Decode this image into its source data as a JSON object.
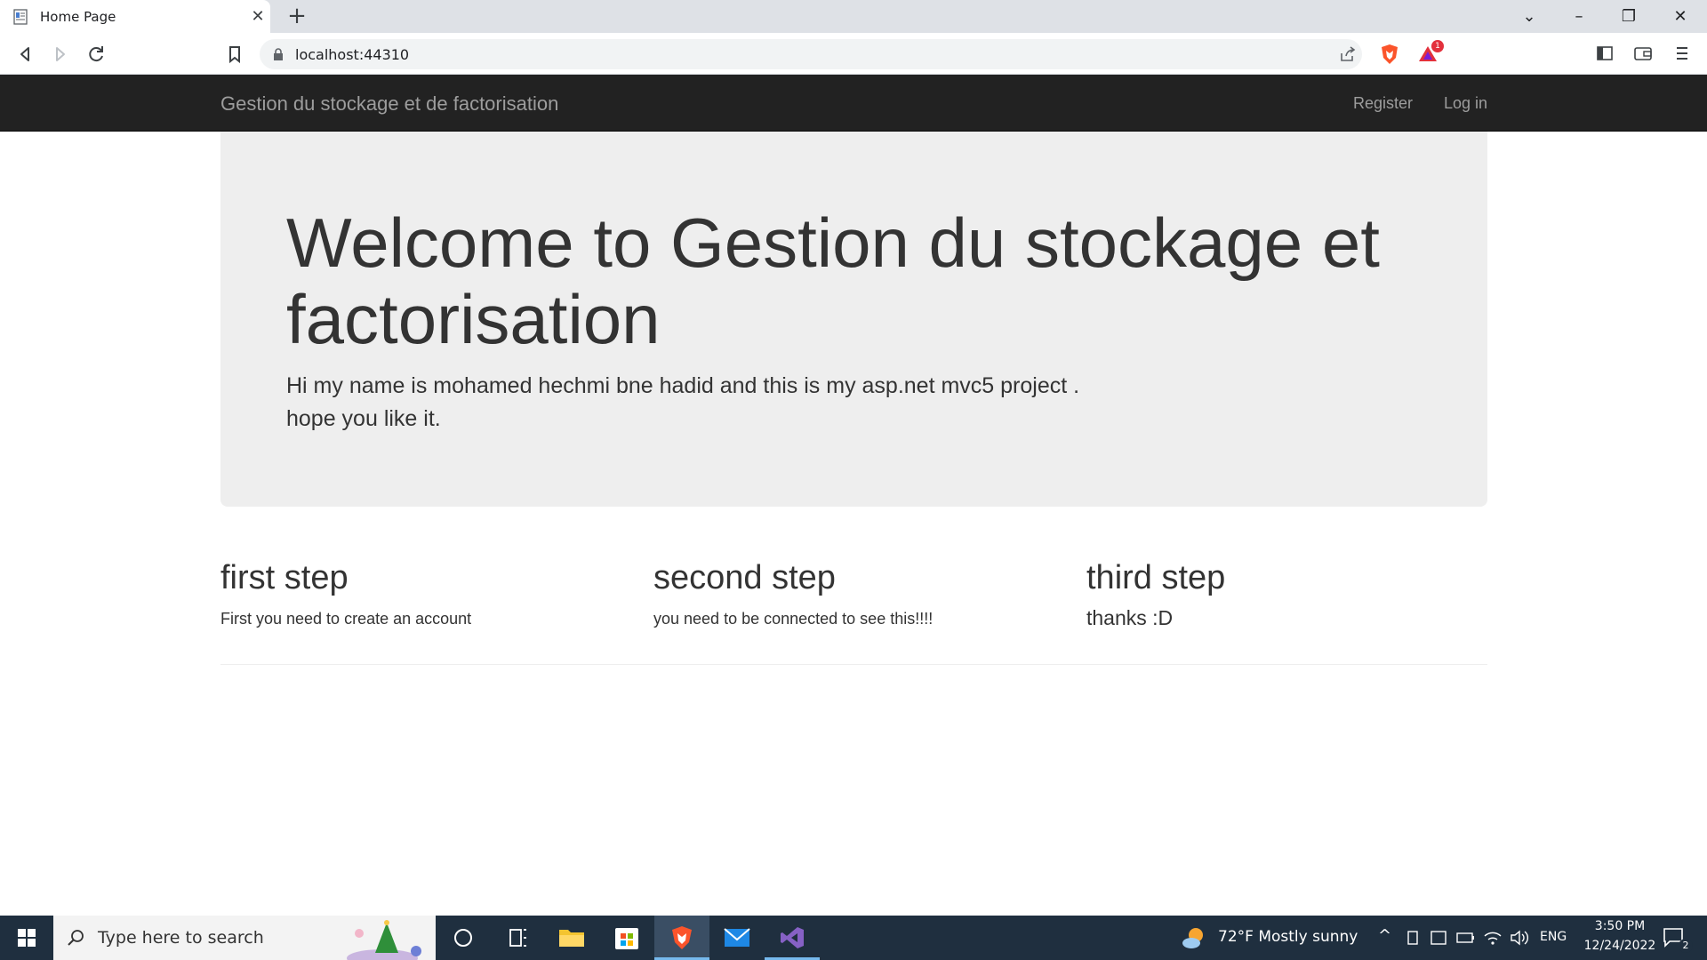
{
  "browser": {
    "tab_title": "Home Page",
    "tab_close": "✕",
    "new_tab": "+",
    "url": "localhost:44310",
    "badge_count": "1",
    "window_buttons": {
      "minimize": "–",
      "restore": "❐",
      "close": "✕",
      "tab_search": "⌄"
    }
  },
  "site": {
    "brand": "Gestion du stockage et de factorisation",
    "nav": {
      "register": "Register",
      "login": "Log in"
    },
    "jumbotron": {
      "title": "Welcome to Gestion du stockage et factorisation",
      "text_line1": "Hi my name is mohamed hechmi bne hadid and this is my asp.net mvc5 project .",
      "text_line2": "hope you like it."
    },
    "columns": [
      {
        "heading": "first step",
        "text": "First you need to create an account"
      },
      {
        "heading": "second step",
        "text": "you need to be connected to see this!!!!"
      },
      {
        "heading": "third step",
        "text": "thanks :D"
      }
    ]
  },
  "taskbar": {
    "search_placeholder": "Type here to search",
    "weather": "72°F  Mostly sunny",
    "language": "ENG",
    "time": "3:50 PM",
    "date": "12/24/2022",
    "notification_count": "2"
  },
  "colors": {
    "navbar_bg": "#222222",
    "nav_text": "#9d9d9d",
    "jumbotron_bg": "#eeeeee",
    "taskbar_bg": "#1f2f3f"
  }
}
